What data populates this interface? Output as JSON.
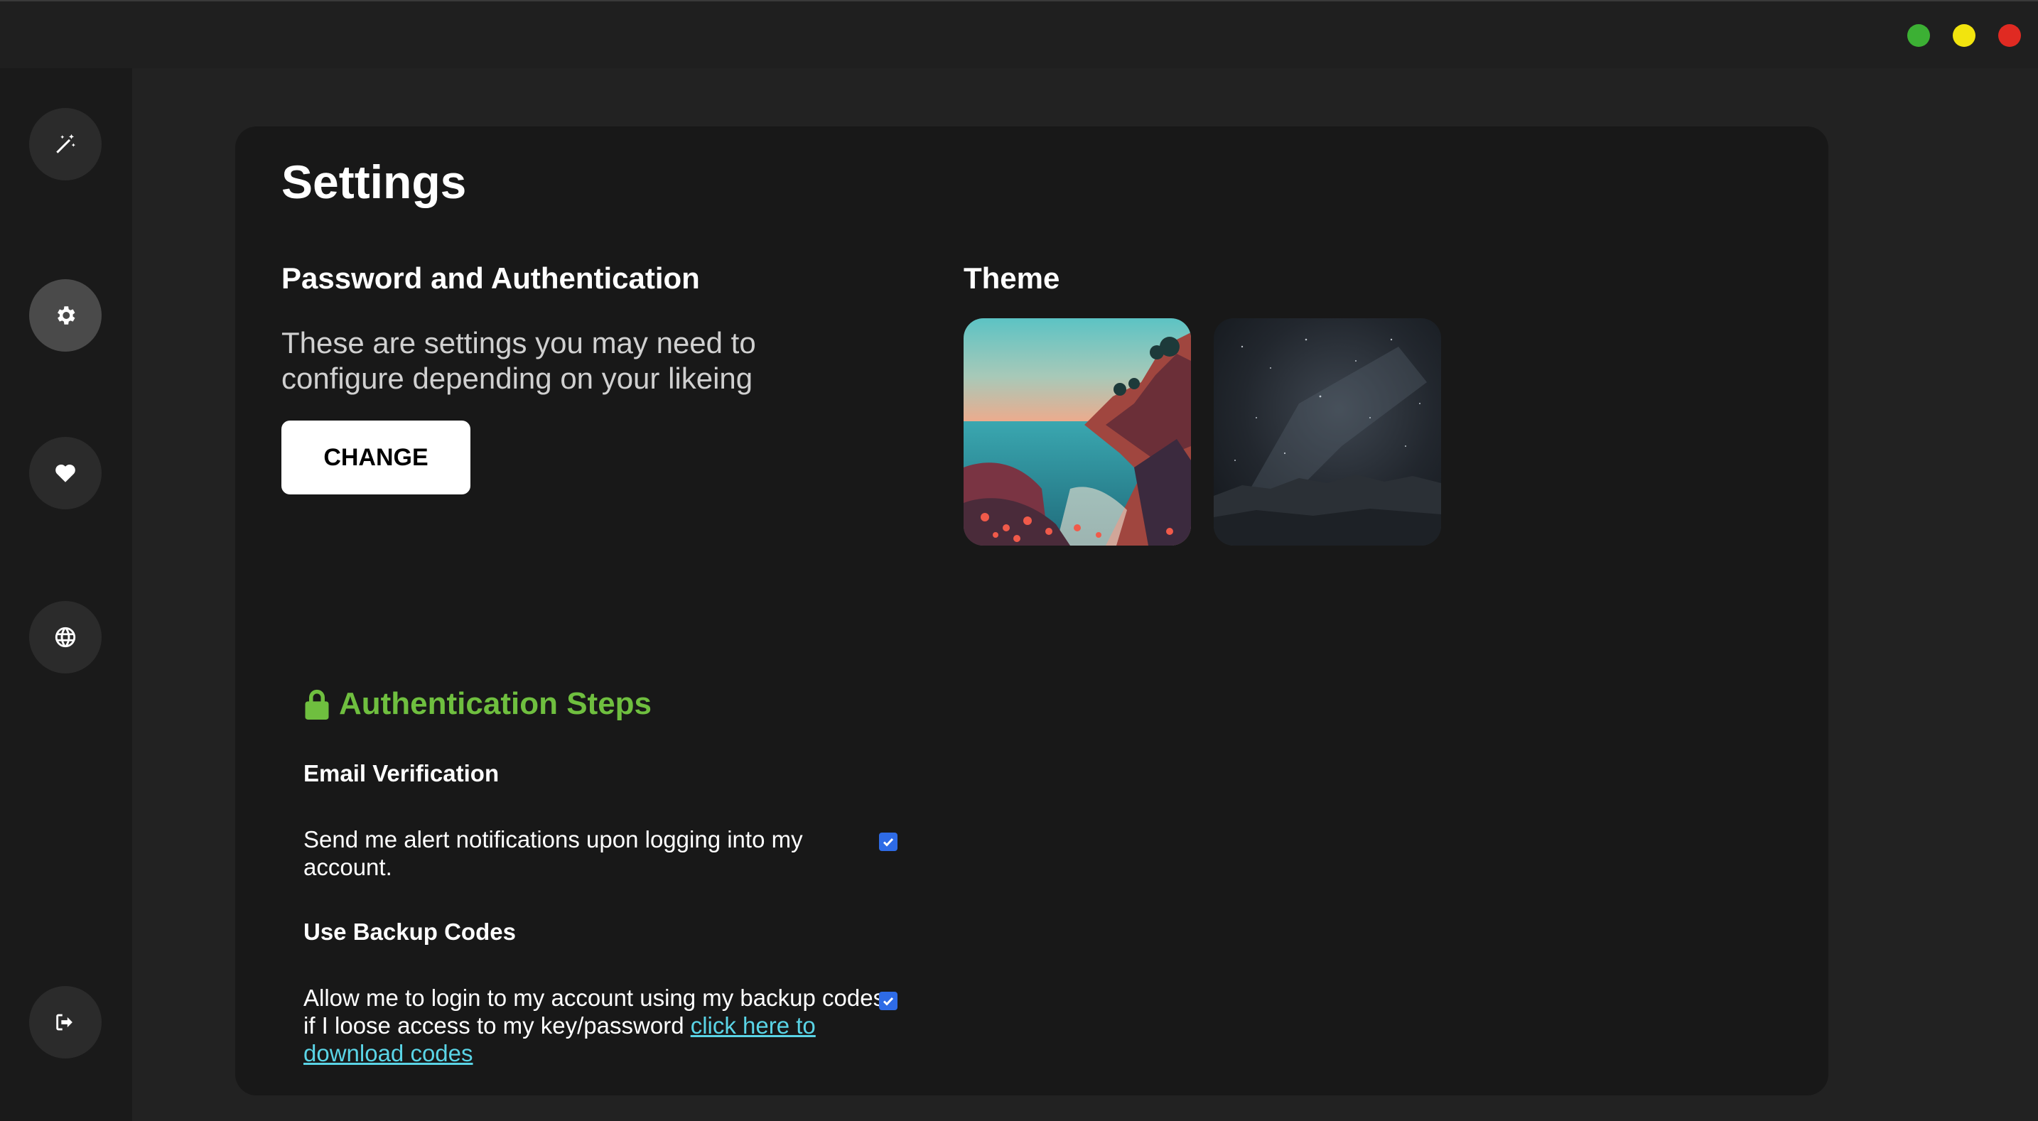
{
  "window": {
    "controls": [
      {
        "name": "green",
        "color": "#3cb034"
      },
      {
        "name": "yellow",
        "color": "#f2e40e"
      },
      {
        "name": "red",
        "color": "#e02a22"
      }
    ]
  },
  "sidebar": {
    "items": [
      {
        "name": "magic-wand-icon",
        "active": false
      },
      {
        "name": "gear-icon",
        "active": true
      },
      {
        "name": "heart-icon",
        "active": false
      },
      {
        "name": "globe-icon",
        "active": false
      },
      {
        "name": "logout-icon",
        "active": false
      }
    ]
  },
  "page": {
    "title": "Settings"
  },
  "password_section": {
    "heading": "Password and Authentication",
    "description": "These are settings you may need to configure depending on your likeing",
    "change_label": "CHANGE"
  },
  "theme_section": {
    "heading": "Theme",
    "themes": [
      {
        "name": "coastal-sunset"
      },
      {
        "name": "night-sky"
      }
    ]
  },
  "auth_steps": {
    "heading": "Authentication Steps",
    "accent_color": "#6fbf3f",
    "email": {
      "title": "Email Verification",
      "description": "Send me alert notifications upon logging into my account.",
      "checked": true
    },
    "backup": {
      "title": "Use Backup Codes",
      "description": "Allow me to login to my account using my backup codes if I loose access to my key/password",
      "link_text": "click here to download codes",
      "checked": true
    }
  }
}
